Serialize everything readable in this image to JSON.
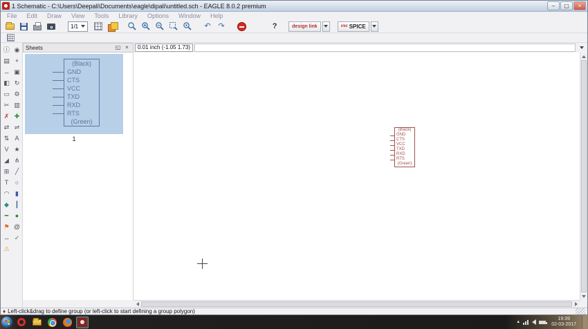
{
  "window": {
    "title": "1 Schematic - C:\\Users\\Deepali\\Documents\\eagle\\dipali\\untitled.sch - EAGLE 8.0.2 premium",
    "minimize": "–",
    "maximize": "▢",
    "close": "×"
  },
  "menu": {
    "items": [
      "File",
      "Edit",
      "Draw",
      "View",
      "Tools",
      "Library",
      "Options",
      "Window",
      "Help"
    ]
  },
  "toolbar": {
    "sheet_selector": "1/1",
    "help": "?",
    "design_link": "design link",
    "spice_prefix": "vsc",
    "spice": "SPICE"
  },
  "icons": {
    "undo": "↶",
    "redo": "↷",
    "undock": "◱",
    "panel_close": "×",
    "info": "ⓘ",
    "show": "◉",
    "display": "▤",
    "mark": "+",
    "move": "↔",
    "copy": "▣",
    "mirror": "◧",
    "rotate": "↻",
    "group": "▭",
    "change": "⚙",
    "cut": "✂",
    "paste": "▥",
    "delete": "✗",
    "add": "✚",
    "pinswap": "⇄",
    "replace": "⇌",
    "gateswap": "⇅",
    "name": "A",
    "value": "V",
    "smash": "★",
    "miter": "◢",
    "split": "⋔",
    "invoke": "⊞",
    "wire": "╱",
    "text": "T",
    "circle": "○",
    "arc": "◠",
    "rect": "▮",
    "polygon": "◆",
    "bus": "┃",
    "net": "━",
    "junction": "●",
    "label": "⚑",
    "attribute": "@",
    "dimension": "↔",
    "erc": "✓",
    "errors": "⚠",
    "tray_up": "▲"
  },
  "sheets": {
    "title": "Sheets",
    "sheet_number": "1"
  },
  "command": {
    "coordinates": "0.01 inch (-1.05 1.73)"
  },
  "component": {
    "pins": [
      "(Black)",
      "GND",
      "CTS",
      "VCC",
      "TXD",
      "RXD",
      "RTS",
      "(Green)"
    ]
  },
  "status": {
    "icon": "♦",
    "message": "Left-click&drag to define group (or left-click to start defining a group polygon)"
  },
  "taskbar": {
    "time": "19:39",
    "date": "02-03-2017"
  }
}
